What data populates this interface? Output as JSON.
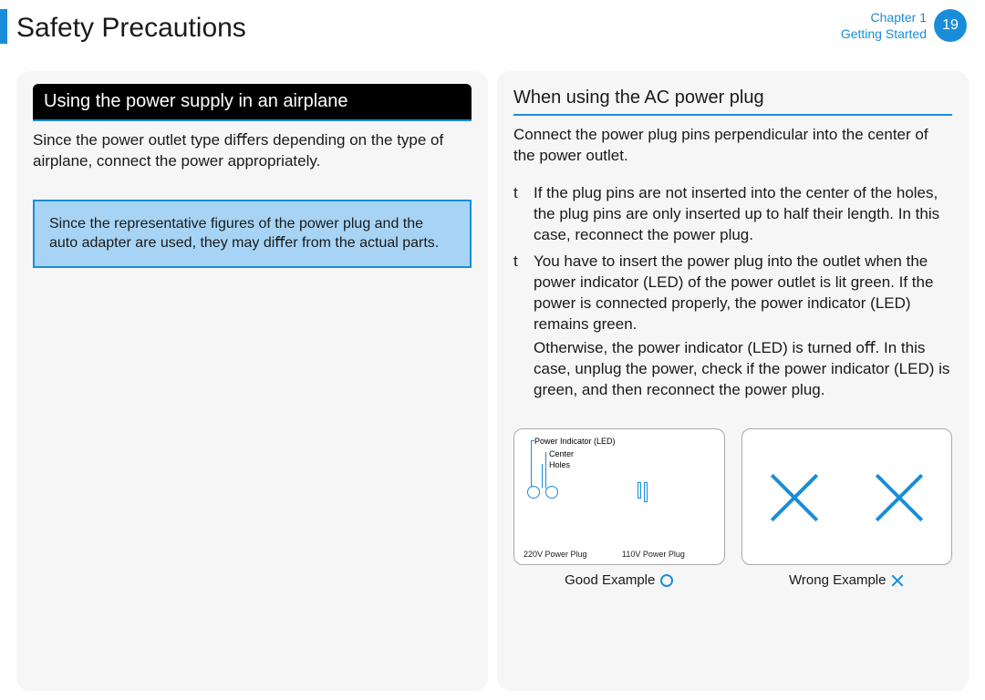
{
  "header": {
    "title": "Safety Precautions",
    "chapter_line1": "Chapter 1",
    "chapter_line2": "Getting Started",
    "page_number": "19"
  },
  "left": {
    "section_title": "Using the power supply in an airplane",
    "intro": "Since the power outlet type diﬀers depending on the type of airplane, connect the power appropriately.",
    "note": "Since the representative ﬁgures of the power plug and the auto adapter are used, they may diﬀer from the actual parts."
  },
  "right": {
    "section_title": "When using the AC power plug",
    "intro": "Connect the power plug pins perpendicular into the center of the power outlet.",
    "bullets": [
      {
        "marker": "t",
        "text": "If the plug pins are not inserted into the center of the holes, the plug pins are only inserted up to half their length. In this case, reconnect the power plug."
      },
      {
        "marker": "t",
        "text": "You have to insert the power plug into the outlet when the power indicator (LED) of the power outlet is lit green. If the power is connected properly, the power indicator (LED) remains green.",
        "sub": "Otherwise, the power indicator (LED) is turned oﬀ. In this case, unplug the power, check if the power indicator (LED) is green, and then reconnect the power plug."
      }
    ],
    "good_fig": {
      "label_led": "Power Indicator (LED)",
      "label_center": "Center",
      "label_holes": "Holes",
      "plug_220": "220V Power Plug",
      "plug_110": "110V Power Plug",
      "caption": "Good Example"
    },
    "wrong_fig": {
      "caption": "Wrong Example"
    }
  }
}
